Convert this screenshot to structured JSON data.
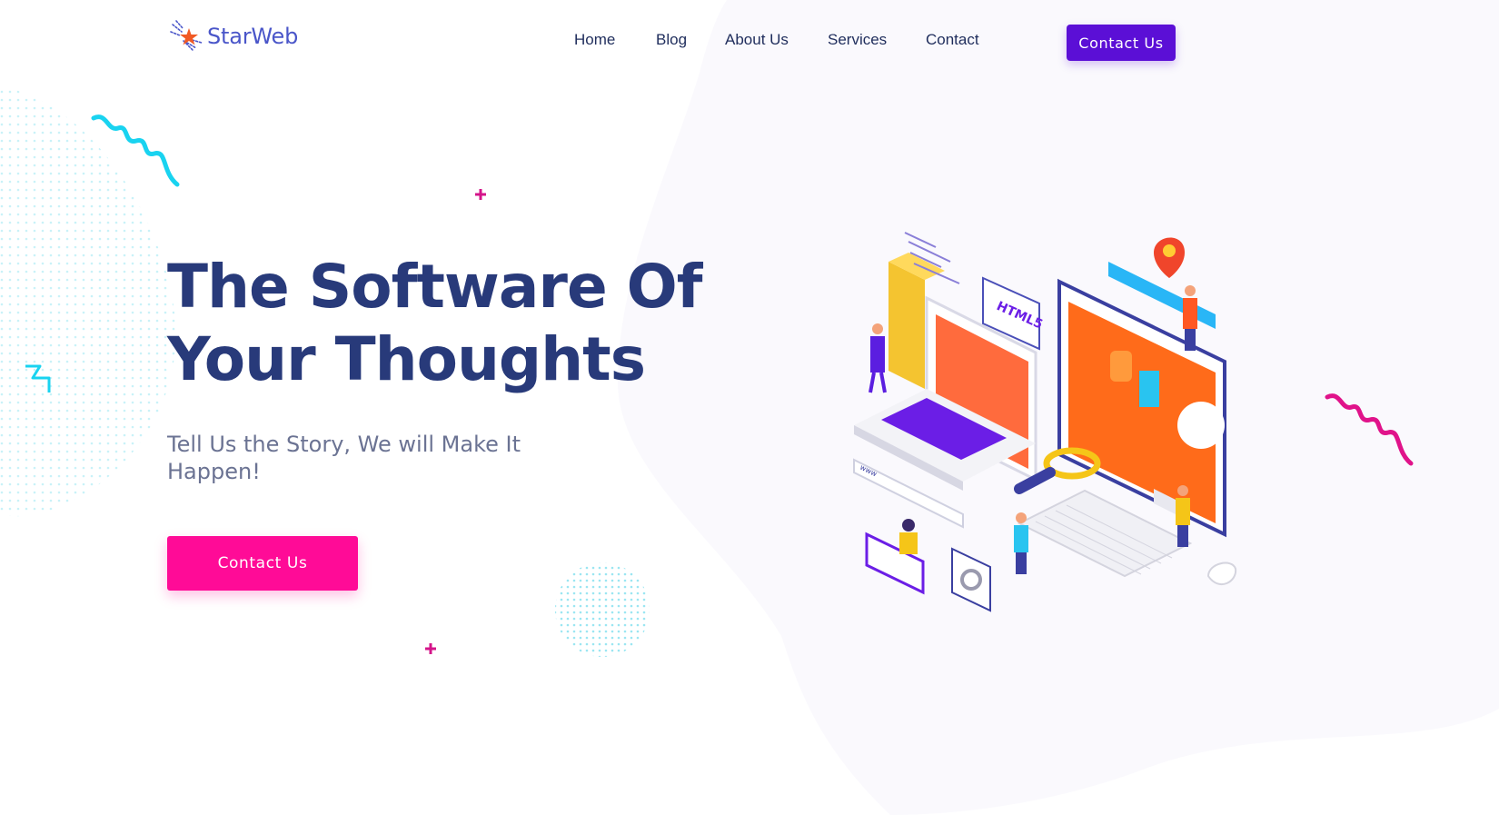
{
  "brand": {
    "name": "StarWeb",
    "icon": "star-logo-icon"
  },
  "nav": {
    "items": [
      {
        "label": "Home"
      },
      {
        "label": "Blog"
      },
      {
        "label": "About Us"
      },
      {
        "label": "Services"
      },
      {
        "label": "Contact"
      }
    ],
    "cta_label": "Contact Us"
  },
  "hero": {
    "title_line1": "The Software Of",
    "title_line2": "Your Thoughts",
    "subtitle": "Tell Us the Story, We will Make It Happen!",
    "cta_label": "Contact Us"
  },
  "illustration": {
    "code_tag": "HTML5",
    "url_tag": "www"
  },
  "colors": {
    "primary_purple": "#5b0fd6",
    "accent_pink": "#ff0b97",
    "heading_navy": "#283a7a",
    "cyan_deco": "#19d3f0",
    "magenta_deco": "#e0138a"
  }
}
